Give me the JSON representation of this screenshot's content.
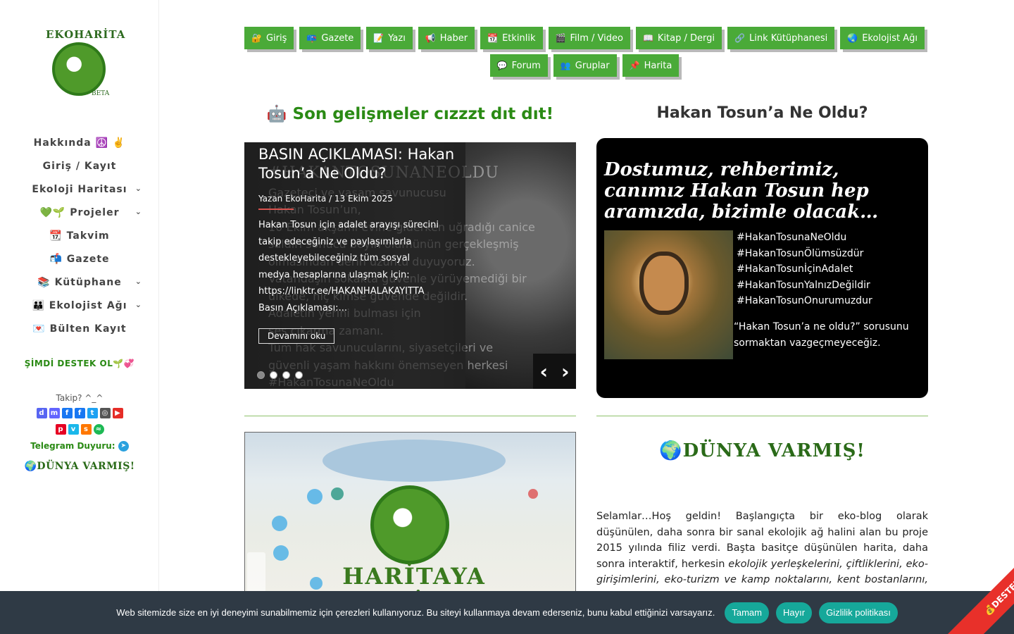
{
  "sidebar": {
    "logo_text": "EKOHARİTA",
    "logo_beta": "BETA",
    "items": [
      {
        "label": "Hakkında ☮️ ✌️",
        "has_sub": false
      },
      {
        "label": "Giriş / Kayıt",
        "has_sub": false
      },
      {
        "label": "Ekoloji Haritası",
        "has_sub": true
      },
      {
        "label": "💚🌱 Projeler",
        "has_sub": true
      },
      {
        "label": "📆 Takvim",
        "has_sub": false
      },
      {
        "label": "📬 Gazete",
        "has_sub": false
      },
      {
        "label": "📚 Kütüphane",
        "has_sub": true
      },
      {
        "label": "👪 Ekolojist Ağı",
        "has_sub": true
      },
      {
        "label": "💌 Bülten Kayıt",
        "has_sub": false
      }
    ],
    "support": "ŞİMDİ DESTEK OL🌱💞",
    "follow": "Takip? ^_^",
    "telegram": "Telegram Duyuru:",
    "dunya": "🌍DÜNYA VARMIŞ!"
  },
  "topnav": {
    "row1": [
      {
        "icon": "🔐",
        "label": "Giriş"
      },
      {
        "icon": "📪",
        "label": "Gazete"
      },
      {
        "icon": "📝",
        "label": "Yazı"
      },
      {
        "icon": "📢",
        "label": "Haber"
      },
      {
        "icon": "📆",
        "label": "Etkinlik"
      },
      {
        "icon": "🎬",
        "label": "Film / Video"
      },
      {
        "icon": "📖",
        "label": "Kitap / Dergi"
      },
      {
        "icon": "🔗",
        "label": "Link Kütüphanesi"
      },
      {
        "icon": "🌏",
        "label": "Ekolojist Ağı"
      }
    ],
    "row2": [
      {
        "icon": "💬",
        "label": "Forum"
      },
      {
        "icon": "👥",
        "label": "Gruplar"
      },
      {
        "icon": "📌",
        "label": "Harita"
      }
    ]
  },
  "sections": {
    "latest_title": "🤖 Son gelişmeler cızzzt dıt dıt!",
    "hakan_title": "Hakan Tosun’a Ne Oldu?"
  },
  "slider": {
    "title": "BASIN AÇIKLAMASI: Hakan Tosun’a Ne Oldu?",
    "meta": "Yazan EkoHarita / 13 Ekim 2025",
    "excerpt": "Hakan Tosun için adalet arayışı sürecini takip edeceğiniz ve paylaşımlarla destekleyebileceğiniz tüm sosyal medya hesaplarına ulaşmak için: https://linktr.ee/HAKANHALAKAYITTA Basın Açıklaması:...",
    "more": "Devamını oku",
    "bg_lines": [
      "#HAKANTOSUNANEOLDU",
      "Gazeteci ve yaşam savunucusu",
      "Hakan Tosun’un,",
      "10 Ekim akşamı evine giderken uğradığı canice",
      "saldırı sonucu beyin ölümünün gerçekleşmiş",
      "olmasından derin üzüntü duyuyoruz.",
      "Vatandaşın sokakta güvenle yürüyemediği bir",
      "ülkede, hiç kimse güvende değildir.",
      "Adaletin yerini bulması için",
      "ses çıkarma zamanı.",
      "Tüm hak savunucularını, siyasetçileri ve",
      "güvenli yaşam hakkını önemseyen herkesi",
      "#HakanTosunaNeOldu"
    ],
    "slides_count": 4,
    "active_index": 0
  },
  "card": {
    "title": "Dostumuz, rehberimiz, canımız Hakan Tosun hep aramızda, bizimle olacak…",
    "tags": [
      "#HakanTosunaNeOldu",
      "#HakanTosunÖlümsüzdür",
      "#HakanTosunİçinAdalet",
      "#HakanTosunYalnızDeğildir",
      "#HakanTosunOnurumuzdur"
    ],
    "quote": "“Hakan Tosun’a ne oldu?” sorusunu sormaktan vazgeçmeyeceğiz."
  },
  "map": {
    "cta": "HARİTAYA ERİŞ!"
  },
  "intro": {
    "heading": "🌍DÜNYA VARMIŞ!",
    "text_start": "Selamlar…Hoş geldin! Başlangıçta bir eko-blog olarak düşünülen, daha sonra bir sanal ekolojik ağ halini alan bu proje 2015 yılında filiz verdi. Başta basitçe düşünülen harita, daha sonra interaktif, herkesin ",
    "text_italic": "ekolojik yerleşkelerini, çiftliklerini, eko-girişimlerini, eko-turizm ve kamp noktalarını, kent bostanlarını, ekoloji kolektiflerini,"
  },
  "cookie": {
    "text": "Web sitemizde size en iyi deneyimi sunabilmemiz için çerezleri kullanıyoruz. Bu siteyi kullanmaya devam ederseniz, bunu kabul ettiğinizi varsayarız.",
    "accept": "Tamam",
    "reject": "Hayır",
    "privacy": "Gizlilik politikası"
  },
  "ribbon": "💰DESTEKLE",
  "colors": {
    "brand_green": "#4aaa38",
    "cookie_bg": "#2f3a45",
    "cookie_btn": "#16a89a",
    "ribbon": "#e8302a"
  }
}
